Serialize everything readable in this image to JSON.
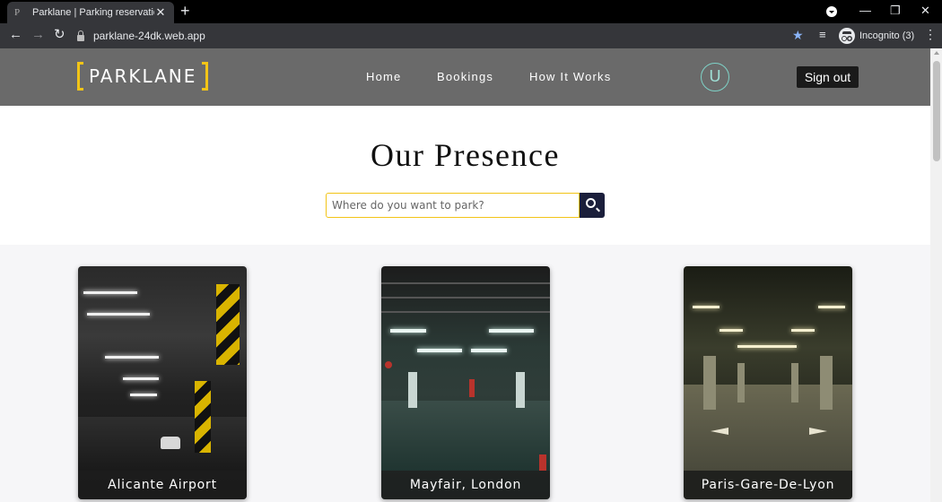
{
  "browser": {
    "tab_favicon": "P",
    "tab_title": "Parklane | Parking reservations",
    "tab_close": "✕",
    "new_tab": "+",
    "url": "parklane-24dk.web.app",
    "incognito_label": "Incognito (3)"
  },
  "header": {
    "logo_text": "PARKLANE",
    "nav": [
      "Home",
      "Bookings",
      "How It Works"
    ],
    "avatar_letter": "U",
    "sign_out": "Sign out"
  },
  "hero": {
    "title": "Our Presence",
    "search_placeholder": "Where do you want to park?"
  },
  "locations": [
    {
      "name": "Alicante Airport"
    },
    {
      "name": "Mayfair, London"
    },
    {
      "name": "Paris-Gare-De-Lyon"
    }
  ],
  "colors": {
    "accent_yellow": "#f2c417",
    "header_gray": "#6a6a6a",
    "search_button": "#1b1f3b",
    "avatar_teal": "#7fd3c8"
  }
}
